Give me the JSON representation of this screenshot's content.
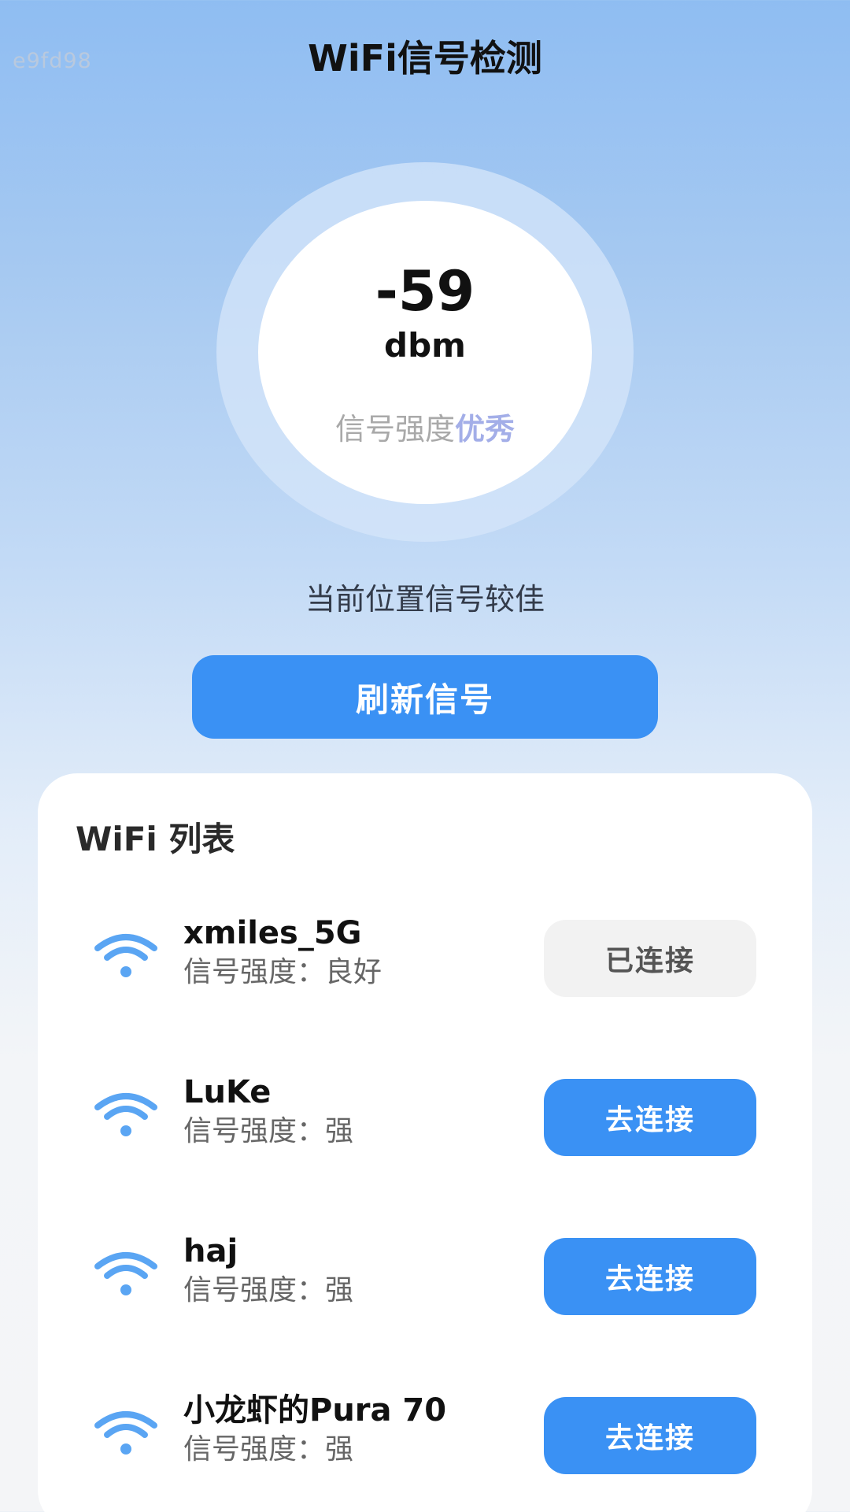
{
  "watermark": "e9fd98",
  "header": {
    "title": "WiFi信号检测"
  },
  "gauge": {
    "value": "-59",
    "unit": "dbm",
    "strength_label": "信号强度",
    "strength_level": "优秀"
  },
  "location_status": "当前位置信号较佳",
  "refresh_button": "刷新信号",
  "wifi_list": {
    "title": "WiFi 列表",
    "items": [
      {
        "name": "xmiles_5G",
        "strength": "信号强度：良好",
        "action": "已连接",
        "state": "connected"
      },
      {
        "name": "LuKe",
        "strength": "信号强度：强",
        "action": "去连接",
        "state": "available"
      },
      {
        "name": "haj",
        "strength": "信号强度：强",
        "action": "去连接",
        "state": "available"
      },
      {
        "name": "小龙虾的Pura 70",
        "strength": "信号强度：强",
        "action": "去连接",
        "state": "available"
      }
    ]
  },
  "colors": {
    "accent": "#3a91f4",
    "wifi_icon": "#5aa5f3",
    "level_text": "#a3aee8"
  },
  "icons": {
    "wifi": "wifi-icon"
  }
}
